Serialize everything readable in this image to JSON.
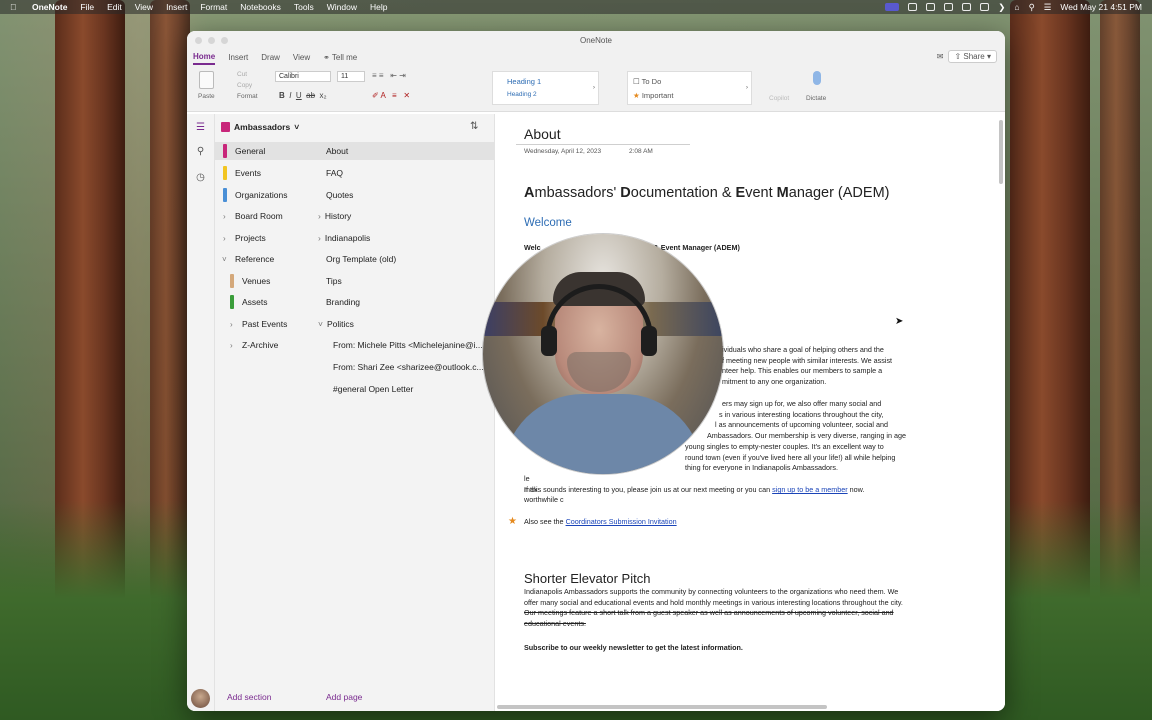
{
  "menubar": {
    "app": "OneNote",
    "items": [
      "File",
      "Edit",
      "View",
      "Insert",
      "Format",
      "Notebooks",
      "Tools",
      "Window",
      "Help"
    ],
    "clock": "Wed May 21  4:51 PM"
  },
  "window": {
    "title": "OneNote"
  },
  "ribbon": {
    "tabs": [
      "Home",
      "Insert",
      "Draw",
      "View"
    ],
    "tell_me": "Tell me",
    "share": "Share",
    "paste": "Paste",
    "cut": "Cut",
    "copy": "Copy",
    "format": "Format",
    "font": "Calibri",
    "size": "11",
    "styles": {
      "h1": "Heading 1",
      "h2": "Heading 2"
    },
    "tags": {
      "todo": "To Do",
      "important": "Important"
    },
    "copilot": "Copilot",
    "dictate": "Dictate"
  },
  "notebook": {
    "name": "Ambassadors"
  },
  "sections": [
    {
      "label": "General",
      "color": "#c8267a"
    },
    {
      "label": "Events",
      "color": "#f2c521"
    },
    {
      "label": "Organizations",
      "color": "#4a8fd6"
    },
    {
      "label": "Board Room"
    },
    {
      "label": "Projects"
    },
    {
      "label": "Reference"
    },
    {
      "label": "Venues",
      "color": "#d4a87a"
    },
    {
      "label": "Assets",
      "color": "#3a9d3a"
    },
    {
      "label": "Past Events"
    },
    {
      "label": "Z-Archive"
    }
  ],
  "pages": [
    "About",
    "FAQ",
    "Quotes",
    "History",
    "Indianapolis",
    "Org Template (old)",
    "Tips",
    "Branding",
    "Politics",
    "From: Michele Pitts <Michelejanine@i...",
    "From: Shari Zee <sharizee@outlook.c...",
    "#general Open Letter"
  ],
  "footer": {
    "add_section": "Add section",
    "add_page": "Add page"
  },
  "page": {
    "title": "About",
    "date": "Wednesday, April 12, 2023",
    "time": "2:08 AM",
    "heading_parts": [
      "A",
      "mbassadors' ",
      "D",
      "ocumentation & ",
      "E",
      "vent ",
      "M",
      "anager (ADEM)"
    ],
    "welcome": "Welcome",
    "welcome_line_a": "Welc",
    "welcome_line_b": "tation & ",
    "welcome_line_c": "E",
    "welcome_line_d": "vent ",
    "welcome_line_e": "M",
    "welcome_line_f": "anager (ADEM)",
    "p1": [
      "ividuals who share a goal of helping others and the",
      "f meeting new people with similar interests. We assist",
      "nteer help. This enables our members to sample a",
      "mitment to any one organization."
    ],
    "p2": [
      "ers may sign up for, we also offer many social and",
      "s in various interesting locations throughout the city,",
      "l as announcements of upcoming volunteer, social and",
      "Ambassadors. Our membership is very diverse, ranging in age",
      "young singles to empty-nester couples. It's an excellent way to",
      "round town (even if you've lived here all your life!) all while helping",
      "thing for everyone in Indianapolis Ambassadors."
    ],
    "p2_left": [
      "",
      "",
      "",
      "",
      "le",
      "mak",
      "worthwhile c"
    ],
    "join_pre": "If this sounds interesting to you, please join us at our next meeting or you can ",
    "join_link": "sign up to be a member",
    "join_post": " now.",
    "also_see": "Also see the ",
    "also_link": "Coordinators Submission Invitation",
    "h2": "Shorter Elevator Pitch",
    "pitch": "Indianapolis Ambassadors supports the community by connecting volunteers to the organizations who need them. We offer many social and educational events and hold monthly meetings in various interesting locations throughout the city. ",
    "pitch_strike": "Our meetings feature a short talk from a guest speaker as well as announcements of upcoming volunteer, social and educational events.",
    "subscribe": "Subscribe to our weekly newsletter to get the latest information."
  }
}
